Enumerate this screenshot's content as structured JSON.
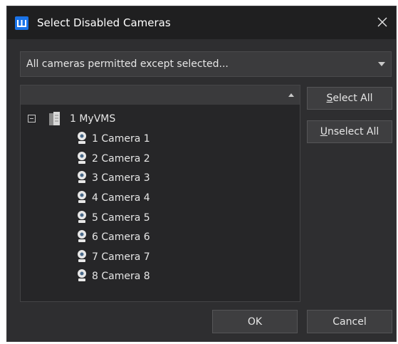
{
  "window": {
    "title": "Select Disabled Cameras"
  },
  "mode_select": {
    "value": "All cameras permitted except selected..."
  },
  "tree": {
    "root": {
      "label": "1 MyVMS"
    },
    "cameras": [
      {
        "label": "1 Camera 1"
      },
      {
        "label": "2 Camera 2"
      },
      {
        "label": "3 Camera 3"
      },
      {
        "label": "4 Camera 4"
      },
      {
        "label": "5 Camera 5"
      },
      {
        "label": "6 Camera 6"
      },
      {
        "label": "7 Camera 7"
      },
      {
        "label": "8 Camera 8"
      }
    ]
  },
  "buttons": {
    "select_all": {
      "mnemonic": "S",
      "rest": "elect All"
    },
    "unselect_all": {
      "mnemonic": "U",
      "rest": "nselect All"
    },
    "ok": "OK",
    "cancel": "Cancel"
  },
  "colors": {
    "dialog_bg": "#2e2e30",
    "titlebar_bg": "#1f1f20",
    "app_icon": "#1a73e8",
    "camera_icon": "#e8e8e8",
    "text": "#e6e6e6"
  },
  "icons": {
    "app": "app-logo-icon",
    "close": "close-icon",
    "dropdown": "chevron-down-icon",
    "sort": "sort-up-icon",
    "collapse": "collapse-minus-icon",
    "server": "server-icon",
    "camera": "webcam-icon"
  }
}
